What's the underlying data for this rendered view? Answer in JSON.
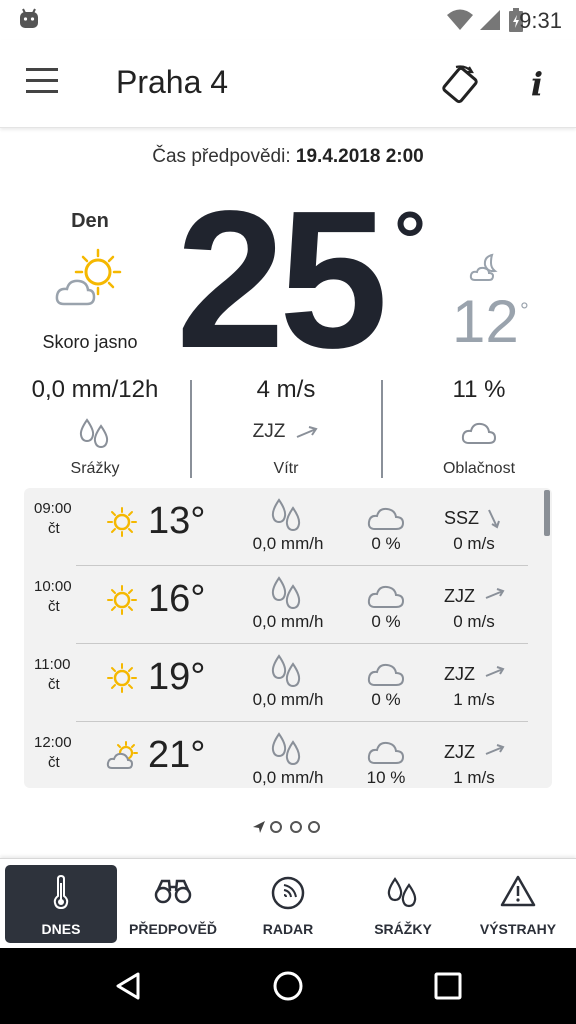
{
  "status_bar": {
    "time": "9:31"
  },
  "app_bar": {
    "title": "Praha 4"
  },
  "forecast": {
    "time_label": "Čas předpovědi:",
    "time_value": "19.4.2018 2:00"
  },
  "current": {
    "day_label": "Den",
    "condition": "Skoro jasno",
    "day_temp": "25",
    "degree": "°",
    "night_temp": "12",
    "night_degree": "°"
  },
  "stats": {
    "precipitation": {
      "value": "0,0 mm/12h",
      "label": "Srážky"
    },
    "wind": {
      "value": "4 m/s",
      "direction": "ZJZ",
      "label": "Vítr"
    },
    "cloudiness": {
      "value": "11 %",
      "label": "Oblačnost"
    }
  },
  "hourly": [
    {
      "time": "09:00",
      "day": "čt",
      "temp": "13°",
      "rain": "0,0 mm/h",
      "cloud": "0 %",
      "wind_dir": "SSZ",
      "wind_speed": "0 m/s",
      "icon": "sun-icon"
    },
    {
      "time": "10:00",
      "day": "čt",
      "temp": "16°",
      "rain": "0,0 mm/h",
      "cloud": "0 %",
      "wind_dir": "ZJZ",
      "wind_speed": "0 m/s",
      "icon": "sun-icon"
    },
    {
      "time": "11:00",
      "day": "čt",
      "temp": "19°",
      "rain": "0,0 mm/h",
      "cloud": "0 %",
      "wind_dir": "ZJZ",
      "wind_speed": "1 m/s",
      "icon": "sun-icon"
    },
    {
      "time": "12:00",
      "day": "čt",
      "temp": "21°",
      "rain": "0,0 mm/h",
      "cloud": "10 %",
      "wind_dir": "ZJZ",
      "wind_speed": "1 m/s",
      "icon": "sun-cloud-icon"
    }
  ],
  "nav": [
    {
      "label": "DNES",
      "icon": "thermometer-icon",
      "active": true
    },
    {
      "label": "PŘEDPOVĚĎ",
      "icon": "binoculars-icon",
      "active": false
    },
    {
      "label": "RADAR",
      "icon": "radar-icon",
      "active": false
    },
    {
      "label": "SRÁŽKY",
      "icon": "raindrops-icon",
      "active": false
    },
    {
      "label": "VÝSTRAHY",
      "icon": "warning-icon",
      "active": false
    }
  ],
  "colors": {
    "accent_dark": "#2e333c",
    "sun_yellow": "#f5b800",
    "night_gray": "#9aa3ad"
  }
}
